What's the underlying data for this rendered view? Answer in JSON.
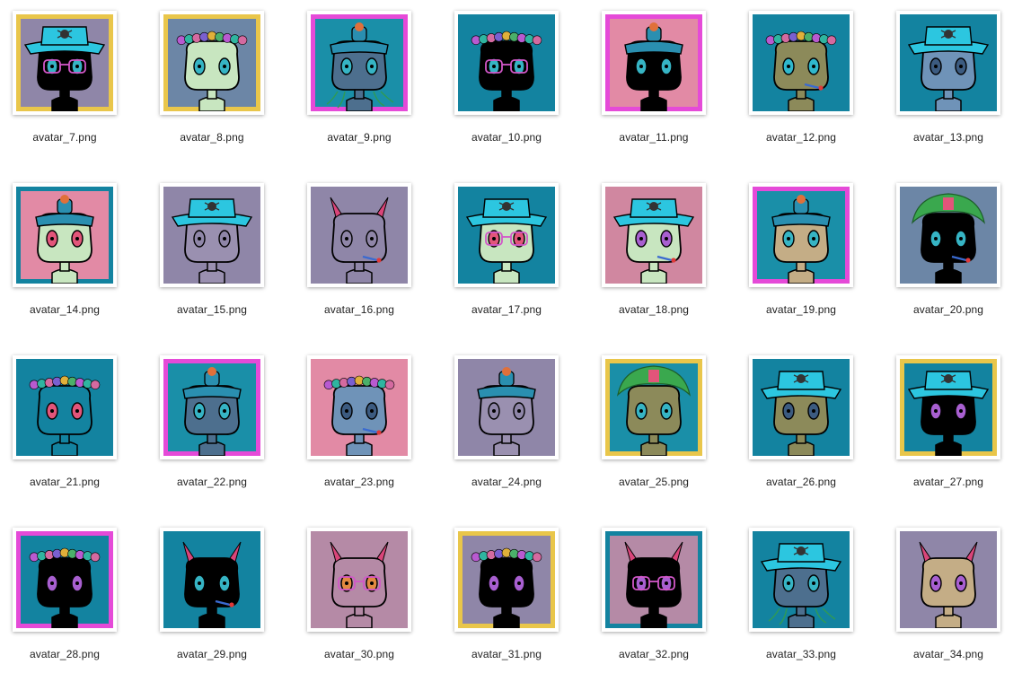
{
  "files": [
    {
      "name": "avatar_7.png",
      "frame": "#e9c64a",
      "bg": "#8f86a8",
      "face": "#000000",
      "hat": "cowboy",
      "accessory": "glasses",
      "eyes": "#36b4c4"
    },
    {
      "name": "avatar_8.png",
      "frame": "#e9c64a",
      "bg": "#6c86a6",
      "face": "#c8e6c0",
      "hat": "flowers",
      "accessory": "none",
      "eyes": "#36b4c4"
    },
    {
      "name": "avatar_9.png",
      "frame": "#e54ad8",
      "bg": "#1a8fa8",
      "face": "#4d6f8e",
      "hat": "pot",
      "accessory": "roots",
      "eyes": "#36b4c4"
    },
    {
      "name": "avatar_10.png",
      "frame": "#1383a0",
      "bg": "#1383a0",
      "face": "#000000",
      "hat": "flowers",
      "accessory": "glasses",
      "eyes": "#36b4c4"
    },
    {
      "name": "avatar_11.png",
      "frame": "#e54ad8",
      "bg": "#e28aa5",
      "face": "#000000",
      "hat": "pot",
      "accessory": "none",
      "eyes": "#36b4c4"
    },
    {
      "name": "avatar_12.png",
      "frame": "#1383a0",
      "bg": "#1383a0",
      "face": "#8c8a5a",
      "hat": "flowers",
      "accessory": "pipe",
      "eyes": "#2fb7cc"
    },
    {
      "name": "avatar_13.png",
      "frame": "#1383a0",
      "bg": "#1383a0",
      "face": "#6f93b8",
      "hat": "cowboy",
      "accessory": "none",
      "eyes": "#3c5b80"
    },
    {
      "name": "avatar_14.png",
      "frame": "#1383a0",
      "bg": "#e28aa5",
      "face": "#c8e6c0",
      "hat": "pot",
      "accessory": "none",
      "eyes": "#e2557a"
    },
    {
      "name": "avatar_15.png",
      "frame": "#8f86a8",
      "bg": "#8f86a8",
      "face": "#9a90b0",
      "hat": "cowboy",
      "accessory": "none",
      "eyes": "#8f86a8"
    },
    {
      "name": "avatar_16.png",
      "frame": "#8f86a8",
      "bg": "#8f86a8",
      "face": "#8f86a8",
      "hat": "horns",
      "accessory": "pipe",
      "eyes": "#8f86a8"
    },
    {
      "name": "avatar_17.png",
      "frame": "#1383a0",
      "bg": "#1383a0",
      "face": "#c8e6c0",
      "hat": "cowboy",
      "accessory": "glasses",
      "eyes": "#e2557a"
    },
    {
      "name": "avatar_18.png",
      "frame": "#d087a0",
      "bg": "#d087a0",
      "face": "#c8e6c0",
      "hat": "cowboy",
      "accessory": "pipe",
      "eyes": "#a85fd0"
    },
    {
      "name": "avatar_19.png",
      "frame": "#e54ad8",
      "bg": "#1a8fa8",
      "face": "#c4ad86",
      "hat": "pot",
      "accessory": "none",
      "eyes": "#36b4c4"
    },
    {
      "name": "avatar_20.png",
      "frame": "#6c86a6",
      "bg": "#6c86a6",
      "face": "#000000",
      "hat": "hair",
      "accessory": "pipe",
      "eyes": "#36b4c4"
    },
    {
      "name": "avatar_21.png",
      "frame": "#1383a0",
      "bg": "#1383a0",
      "face": "#1383a0",
      "hat": "flowers",
      "accessory": "none",
      "eyes": "#e2557a"
    },
    {
      "name": "avatar_22.png",
      "frame": "#e54ad8",
      "bg": "#1a8fa8",
      "face": "#4d6f8e",
      "hat": "pot",
      "accessory": "none",
      "eyes": "#36b4c4"
    },
    {
      "name": "avatar_23.png",
      "frame": "#e28aa5",
      "bg": "#e28aa5",
      "face": "#6f93b8",
      "hat": "flowers",
      "accessory": "pipe",
      "eyes": "#3c5b80"
    },
    {
      "name": "avatar_24.png",
      "frame": "#8f86a8",
      "bg": "#8f86a8",
      "face": "#9a90b0",
      "hat": "pot",
      "accessory": "none",
      "eyes": "#8f86a8"
    },
    {
      "name": "avatar_25.png",
      "frame": "#e9c64a",
      "bg": "#1a8fa8",
      "face": "#8c8a5a",
      "hat": "hair",
      "accessory": "none",
      "eyes": "#36b4c4"
    },
    {
      "name": "avatar_26.png",
      "frame": "#1383a0",
      "bg": "#1383a0",
      "face": "#8c8a5a",
      "hat": "cowboy",
      "accessory": "none",
      "eyes": "#3c5b80"
    },
    {
      "name": "avatar_27.png",
      "frame": "#e9c64a",
      "bg": "#1383a0",
      "face": "#000000",
      "hat": "cowboy",
      "accessory": "none",
      "eyes": "#a85fd0"
    },
    {
      "name": "avatar_28.png",
      "frame": "#e54ad8",
      "bg": "#1383a0",
      "face": "#000000",
      "hat": "flowers",
      "accessory": "none",
      "eyes": "#a85fd0"
    },
    {
      "name": "avatar_29.png",
      "frame": "#1383a0",
      "bg": "#1383a0",
      "face": "#000000",
      "hat": "horns",
      "accessory": "pipe",
      "eyes": "#36b4c4"
    },
    {
      "name": "avatar_30.png",
      "frame": "#b58aa6",
      "bg": "#b58aa6",
      "face": "#b58aa6",
      "hat": "horns",
      "accessory": "glasses",
      "eyes": "#e28a40"
    },
    {
      "name": "avatar_31.png",
      "frame": "#e9c64a",
      "bg": "#8f86a8",
      "face": "#000000",
      "hat": "flowers",
      "accessory": "none",
      "eyes": "#a85fd0"
    },
    {
      "name": "avatar_32.png",
      "frame": "#1383a0",
      "bg": "#b58aa6",
      "face": "#000000",
      "hat": "horns",
      "accessory": "glasses",
      "eyes": "#a85fd0"
    },
    {
      "name": "avatar_33.png",
      "frame": "#1383a0",
      "bg": "#1383a0",
      "face": "#4d6f8e",
      "hat": "cowboy",
      "accessory": "roots",
      "eyes": "#36b4c4"
    },
    {
      "name": "avatar_34.png",
      "frame": "#8f86a8",
      "bg": "#8f86a8",
      "face": "#c4ad86",
      "hat": "horns",
      "accessory": "none",
      "eyes": "#a85fd0"
    }
  ]
}
